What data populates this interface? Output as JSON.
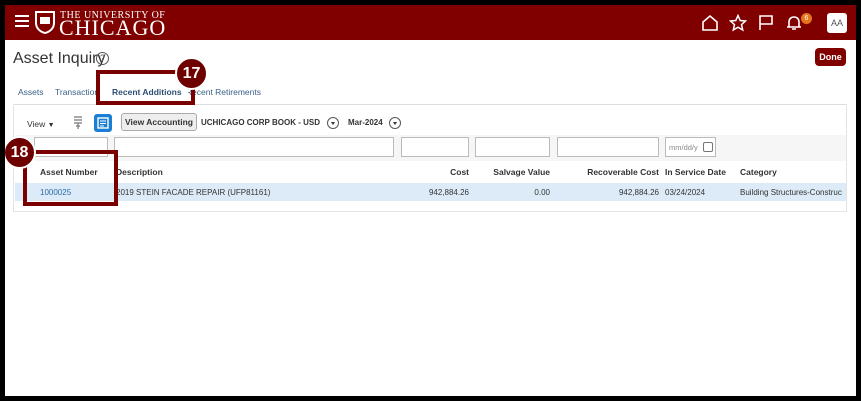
{
  "header": {
    "logo_top": "THE UNIVERSITY OF",
    "logo_main": "CHICAGO",
    "notification_count": "6",
    "avatar_initials": "AA"
  },
  "page": {
    "title": "Asset Inquiry",
    "help": "?",
    "done_label": "Done"
  },
  "tabs": [
    {
      "label": "Assets"
    },
    {
      "label": "Transactions"
    },
    {
      "label": "Recent Additions",
      "active": true
    },
    {
      "label": "Recent Retirements"
    }
  ],
  "toolbar": {
    "view_label": "View",
    "view_accounting_label": "View Accounting",
    "book": "UCHICAGO CORP BOOK - USD",
    "period": "Mar-2024"
  },
  "filters": {
    "date_placeholder": "mm/dd/y"
  },
  "table": {
    "columns": [
      "Asset Number",
      "Description",
      "Cost",
      "Salvage Value",
      "Recoverable Cost",
      "In Service Date",
      "Category"
    ],
    "rows": [
      {
        "asset_number": "1000025",
        "description": "2019 STEIN FACADE REPAIR (UFP81161)",
        "cost": "942,884.26",
        "salvage_value": "0.00",
        "recoverable_cost": "942,884.26",
        "in_service_date": "03/24/2024",
        "category": "Building Structures-Construc"
      }
    ]
  },
  "callouts": [
    {
      "number": "17"
    },
    {
      "number": "18"
    }
  ],
  "colors": {
    "brand": "#800000",
    "link": "#2d6ba5",
    "selected_row": "#dcebf7",
    "callout": "#7a0000"
  }
}
